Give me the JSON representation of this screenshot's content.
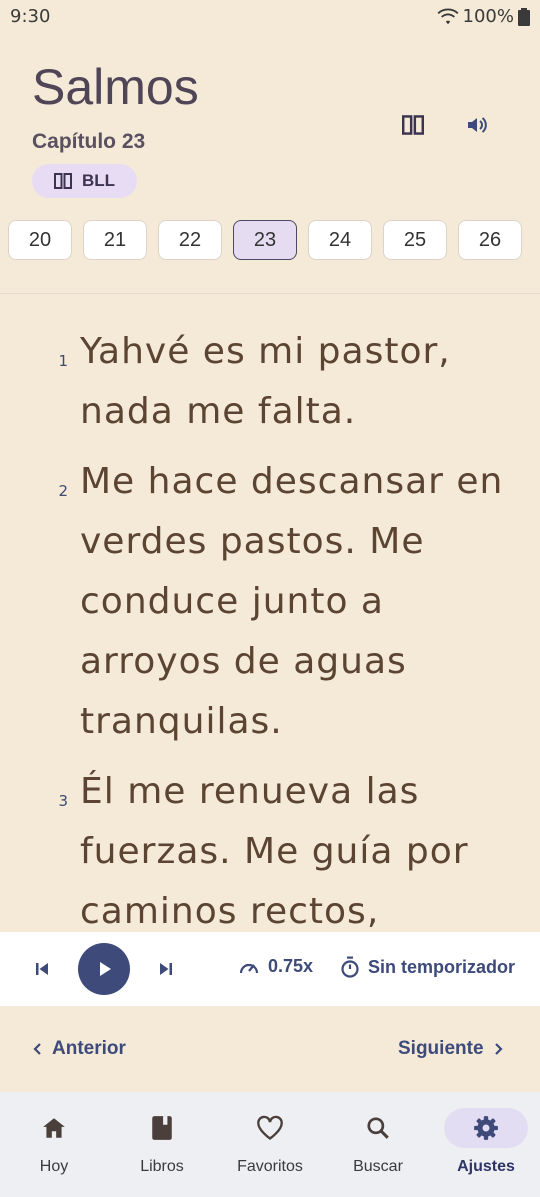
{
  "status_bar": {
    "time": "9:30",
    "battery": "100%"
  },
  "header": {
    "title": "Salmos",
    "subtitle": "Capítulo 23",
    "version_badge": "BLL"
  },
  "chapters": [
    "20",
    "21",
    "22",
    "23",
    "24",
    "25",
    "26"
  ],
  "active_chapter": "23",
  "verses": [
    {
      "num": "1",
      "text": "Yahvé es mi pastor, nada me falta."
    },
    {
      "num": "2",
      "text": "Me hace descansar en verdes pastos. Me conduce junto a arroyos de aguas tranquilas."
    },
    {
      "num": "3",
      "text": "Él me renueva las fuerzas. Me guía por caminos rectos, haciendo honor a su"
    }
  ],
  "player": {
    "speed": "0.75x",
    "timer": "Sin temporizador"
  },
  "navigation": {
    "prev": "Anterior",
    "next": "Siguiente"
  },
  "bottom_nav": [
    {
      "label": "Hoy",
      "icon": "home-icon"
    },
    {
      "label": "Libros",
      "icon": "book-icon"
    },
    {
      "label": "Favoritos",
      "icon": "heart-icon"
    },
    {
      "label": "Buscar",
      "icon": "search-icon"
    },
    {
      "label": "Ajustes",
      "icon": "gear-icon"
    }
  ],
  "active_tab": "Ajustes",
  "colors": {
    "background": "#f4ead7",
    "accent": "#3d4a7a",
    "highlight": "#e6dcf2",
    "verse_text": "#5b4432"
  }
}
